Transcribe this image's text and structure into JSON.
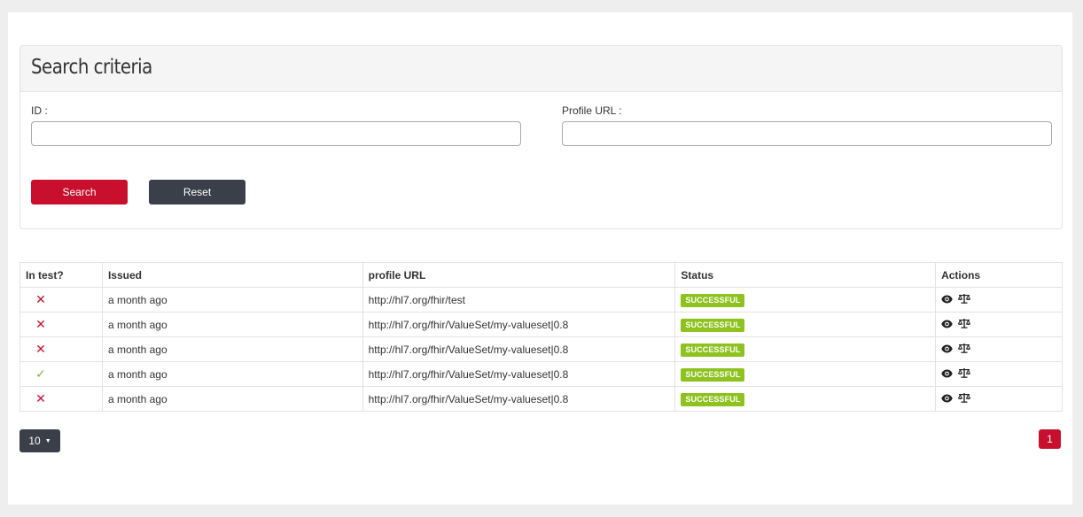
{
  "search": {
    "title": "Search criteria",
    "id_label": "ID :",
    "id_value": "",
    "profile_url_label": "Profile URL :",
    "profile_url_value": "",
    "search_button": "Search",
    "reset_button": "Reset"
  },
  "table": {
    "headers": [
      "In test?",
      "Issued",
      "profile URL",
      "Status",
      "Actions"
    ],
    "rows": [
      {
        "in_test": false,
        "issued": "a month ago",
        "url": "http://hl7.org/fhir/test",
        "status": "SUCCESSFUL"
      },
      {
        "in_test": false,
        "issued": "a month ago",
        "url": "http://hl7.org/fhir/ValueSet/my-valueset|0.8",
        "status": "SUCCESSFUL"
      },
      {
        "in_test": false,
        "issued": "a month ago",
        "url": "http://hl7.org/fhir/ValueSet/my-valueset|0.8",
        "status": "SUCCESSFUL"
      },
      {
        "in_test": true,
        "issued": "a month ago",
        "url": "http://hl7.org/fhir/ValueSet/my-valueset|0.8",
        "status": "SUCCESSFUL"
      },
      {
        "in_test": false,
        "issued": "a month ago",
        "url": "http://hl7.org/fhir/ValueSet/my-valueset|0.8",
        "status": "SUCCESSFUL"
      }
    ],
    "action_icons": [
      "eye-icon",
      "balance-scale-icon"
    ]
  },
  "pagination": {
    "page_size": "10",
    "current_page": "1"
  },
  "colors": {
    "primary_red": "#c8102e",
    "dark_button": "#3a3f4a",
    "success_green": "#8dc21f",
    "check_green": "#7db543"
  }
}
